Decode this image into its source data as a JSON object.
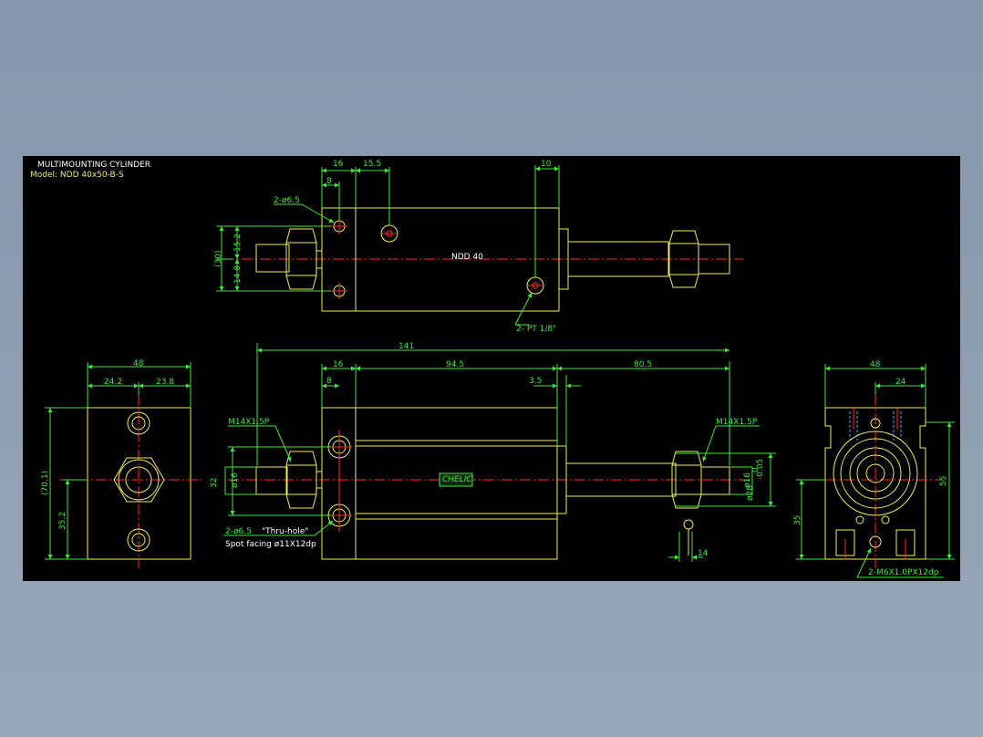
{
  "title_block": {
    "line1": "MULTIMOUNTING CYLINDER",
    "line2": "Model:  NDD 40x50-B-S"
  },
  "top_view": {
    "dim_16": "16",
    "dim_15_5": "15.5",
    "dim_10": "10",
    "dim_8": "8",
    "hole_note": "2-ø6.5",
    "dim_30": "(30)",
    "dim_15_2": "15.2",
    "dim_14_8": "14.8",
    "port_note": "2-  PT 1/8\"",
    "small_mark": "NDD 40"
  },
  "left_view": {
    "dim_48": "48",
    "dim_24_2": "24.2",
    "dim_23_8": "23.8",
    "dim_70_1": "(70.1)",
    "dim_35_2": "35.2"
  },
  "front_view": {
    "dim_141": "141",
    "dim_16": "16",
    "dim_94_5": "94.5",
    "dim_80_5": "80.5",
    "dim_8": "8",
    "dim_3_5": "3.5",
    "thread_left": "M14X1.5P",
    "thread_right": "M14X1.5P",
    "dim_32": "32",
    "dim_phi16_left": "ø16",
    "dim_phi16_right": "ø16",
    "dim_phi28": "ø28",
    "tol_upper": "0",
    "tol_lower": "-0.05",
    "hole_note1": "2-ø6.5",
    "hole_note1b": "\"Thru-hole\"",
    "hole_note2": "Spot facing  ø11X12dp",
    "dim_14": "14",
    "brand": "CHELIC"
  },
  "right_view": {
    "dim_48": "48",
    "dim_24": "24",
    "dim_55": "55",
    "dim_35": "35",
    "thread_note": "2-M6X1.0PX12dp"
  },
  "colors": {
    "background": "#000000",
    "outline": "#f0ee60",
    "dimension": "#3fe83f",
    "centerline": "#ff2a2a",
    "hidden": "#4aa8ff",
    "text": "#ffffff",
    "desktop": "#8b9bae"
  }
}
